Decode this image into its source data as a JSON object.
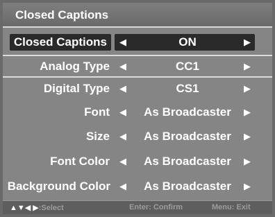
{
  "menu": {
    "title": "Closed Captions",
    "rows": [
      {
        "label": "Closed Captions",
        "value": "ON"
      },
      {
        "label": "Analog Type",
        "value": "CC1"
      },
      {
        "label": "Digital Type",
        "value": "CS1"
      },
      {
        "label": "Font",
        "value": "As Broadcaster"
      },
      {
        "label": "Size",
        "value": "As Broadcaster"
      },
      {
        "label": "Font Color",
        "value": "As Broadcaster"
      },
      {
        "label": "Background Color",
        "value": "As Broadcaster"
      }
    ]
  },
  "footer": {
    "nav_glyphs": "▲▼◀ ▶",
    "nav_label": ":Select",
    "confirm": "Enter: Confirm",
    "exit": "Menu: Exit"
  },
  "glyphs": {
    "left": "◀",
    "right": "▶"
  },
  "colors": {
    "panel": "#858585",
    "highlight": "#2a2a2a",
    "text": "#ffffff"
  }
}
